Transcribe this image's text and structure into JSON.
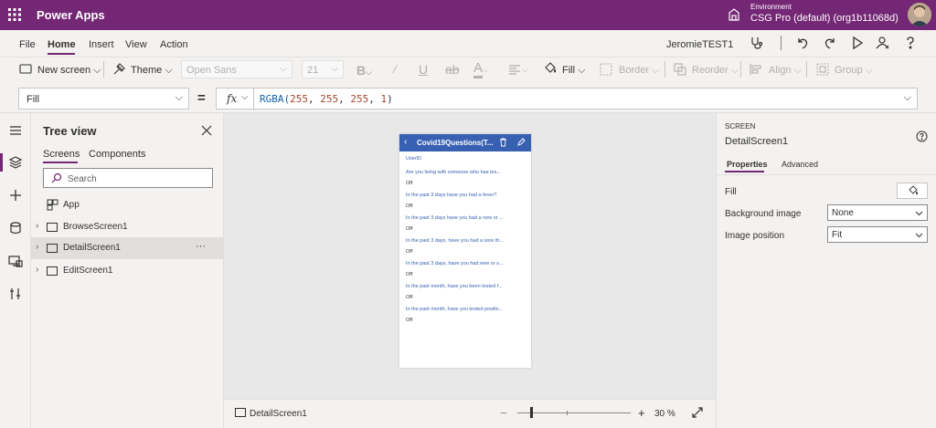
{
  "header": {
    "app_title": "Power Apps",
    "environment_label": "Environment",
    "environment_value": "CSG Pro (default) (org1b11068d)"
  },
  "menu": {
    "items": [
      "File",
      "Home",
      "Insert",
      "View",
      "Action"
    ],
    "app_name": "JeromieTEST1"
  },
  "toolbar": {
    "new_screen": "New screen",
    "theme": "Theme",
    "font": "Open Sans",
    "font_size": "21",
    "fill": "Fill",
    "border": "Border",
    "reorder": "Reorder",
    "align": "Align",
    "group": "Group"
  },
  "formula": {
    "property": "Fill",
    "equals": "=",
    "fx": "fx",
    "value": "RGBA(255, 255, 255, 1)"
  },
  "tree": {
    "title": "Tree view",
    "tabs": [
      "Screens",
      "Components"
    ],
    "search_placeholder": "Search",
    "items": [
      {
        "label": "App"
      },
      {
        "label": "BrowseScreen1"
      },
      {
        "label": "DetailScreen1",
        "more": "···"
      },
      {
        "label": "EditScreen1"
      }
    ]
  },
  "preview": {
    "title": "Covid19Questions(T...",
    "user_field": "UserID",
    "questions": [
      {
        "q": "Are you living with someone who has tes...",
        "a": "Off"
      },
      {
        "q": "In the past 3 days have you had a fever?",
        "a": "Off"
      },
      {
        "q": "In the past 3 days have you had a new or ...",
        "a": "Off"
      },
      {
        "q": "In the past 3 days, have you had a sore th...",
        "a": "Off"
      },
      {
        "q": "In the past 3 days, have you had new or s...",
        "a": "Off"
      },
      {
        "q": "In the past month, have you been tested f...",
        "a": "Off"
      },
      {
        "q": "In the past month, have you tested positiv...",
        "a": "Off"
      }
    ]
  },
  "status": {
    "screen": "DetailScreen1",
    "minus": "−",
    "plus": "+",
    "zoom": "30 %",
    "zoom_value_percent": 30
  },
  "properties": {
    "kind": "SCREEN",
    "name": "DetailScreen1",
    "tabs": [
      "Properties",
      "Advanced"
    ],
    "fill_label": "Fill",
    "background_label": "Background image",
    "background_value": "None",
    "position_label": "Image position",
    "position_value": "Fit"
  },
  "colors": {
    "brand": "#742774",
    "preview_header": "#3860b2",
    "formula_number": "#a5462d"
  }
}
